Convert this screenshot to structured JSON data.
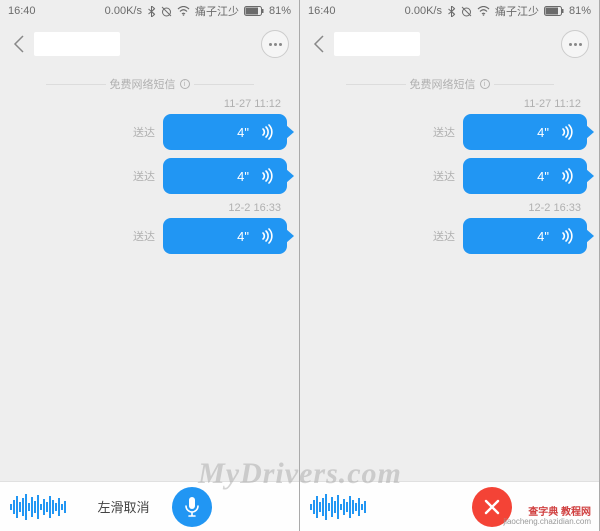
{
  "status_bar": {
    "time": "16:40",
    "speed": "0.00K/s",
    "carrier": "痛子江少",
    "battery": "81%"
  },
  "banner": {
    "text": "免费网络短信",
    "info_char": "i"
  },
  "messages": {
    "ts1": "11-27 11:12",
    "ts2": "12-2 16:33",
    "delivered": "送达",
    "duration": "4\""
  },
  "footer_left": {
    "hint": "左滑取消"
  },
  "watermark": {
    "main": "MyDrivers.com",
    "corner_top": "查字典 教程网",
    "corner_bottom": "jiaocheng.chazidian.com"
  }
}
